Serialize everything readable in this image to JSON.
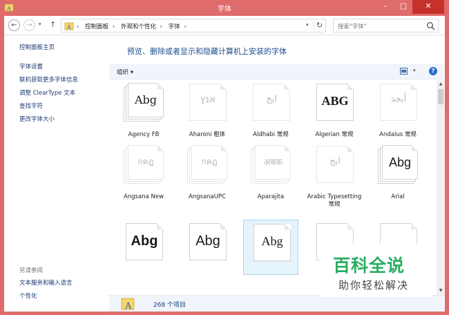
{
  "window": {
    "title": "字体",
    "minimize": "–",
    "maximize": "▢",
    "close": "✕",
    "frame_color": "#e06b6b",
    "close_color": "#c7312b"
  },
  "nav": {
    "back": "←",
    "forward": "→",
    "history": "▾",
    "up": "↑",
    "refresh": "↻"
  },
  "address": {
    "crumbs": [
      "控制面板",
      "外观和个性化",
      "字体"
    ],
    "separator": "›",
    "dropdown": "▾"
  },
  "search": {
    "placeholder": "搜索\"字体\""
  },
  "sidebar": {
    "home": "控制面板主页",
    "links": [
      "字体设置",
      "联机获取更多字体信息",
      "调整 ClearType 文本",
      "查找字符",
      "更改字体大小"
    ],
    "see_also_label": "另请参阅",
    "see_also": [
      "文本服务和输入语言",
      "个性化"
    ]
  },
  "main": {
    "heading": "预览、删除或者显示和隐藏计算机上安装的字体"
  },
  "toolbar": {
    "organize": "组织",
    "organize_arrow": "▾",
    "view_dd": "▾",
    "help": "?"
  },
  "fonts": [
    {
      "name": "Agency FB",
      "sample": "Abg",
      "faded": false,
      "stack": true,
      "selected": false
    },
    {
      "name": "Aharoni 粗体",
      "sample": "אנץ",
      "faded": true,
      "stack": false,
      "selected": false
    },
    {
      "name": "Aldhabi 常规",
      "sample": "ابج",
      "faded": true,
      "stack": false,
      "selected": false
    },
    {
      "name": "Algerian 常规",
      "sample": "ABG",
      "faded": false,
      "stack": false,
      "selected": false
    },
    {
      "name": "Andalus 常规",
      "sample": "أبجد",
      "faded": true,
      "stack": false,
      "selected": false
    },
    {
      "name": "Angsana New",
      "sample": "กคฎ",
      "faded": true,
      "stack": true,
      "selected": false
    },
    {
      "name": "AngsanaUPC",
      "sample": "กคฎ",
      "faded": true,
      "stack": true,
      "selected": false
    },
    {
      "name": "Aparajita",
      "sample": "अबक",
      "faded": true,
      "stack": true,
      "selected": false
    },
    {
      "name": "Arabic Typesetting 常规",
      "sample": "ابج",
      "faded": true,
      "stack": false,
      "selected": false
    },
    {
      "name": "Arial",
      "sample": "Abg",
      "faded": false,
      "stack": true,
      "selected": false
    },
    {
      "name": "",
      "sample": "Abg",
      "faded": false,
      "stack": false,
      "selected": false
    },
    {
      "name": "",
      "sample": "Abg",
      "faded": false,
      "stack": false,
      "selected": false
    },
    {
      "name": "",
      "sample": "Abg",
      "faded": false,
      "stack": false,
      "selected": true
    },
    {
      "name": "",
      "sample": "",
      "faded": false,
      "stack": false,
      "selected": false
    },
    {
      "name": "",
      "sample": "",
      "faded": false,
      "stack": false,
      "selected": false
    }
  ],
  "status": {
    "count": "268 个项目"
  },
  "watermark": {
    "title": "百科全说",
    "subtitle": "助你轻松解决",
    "color": "#27ae60"
  }
}
